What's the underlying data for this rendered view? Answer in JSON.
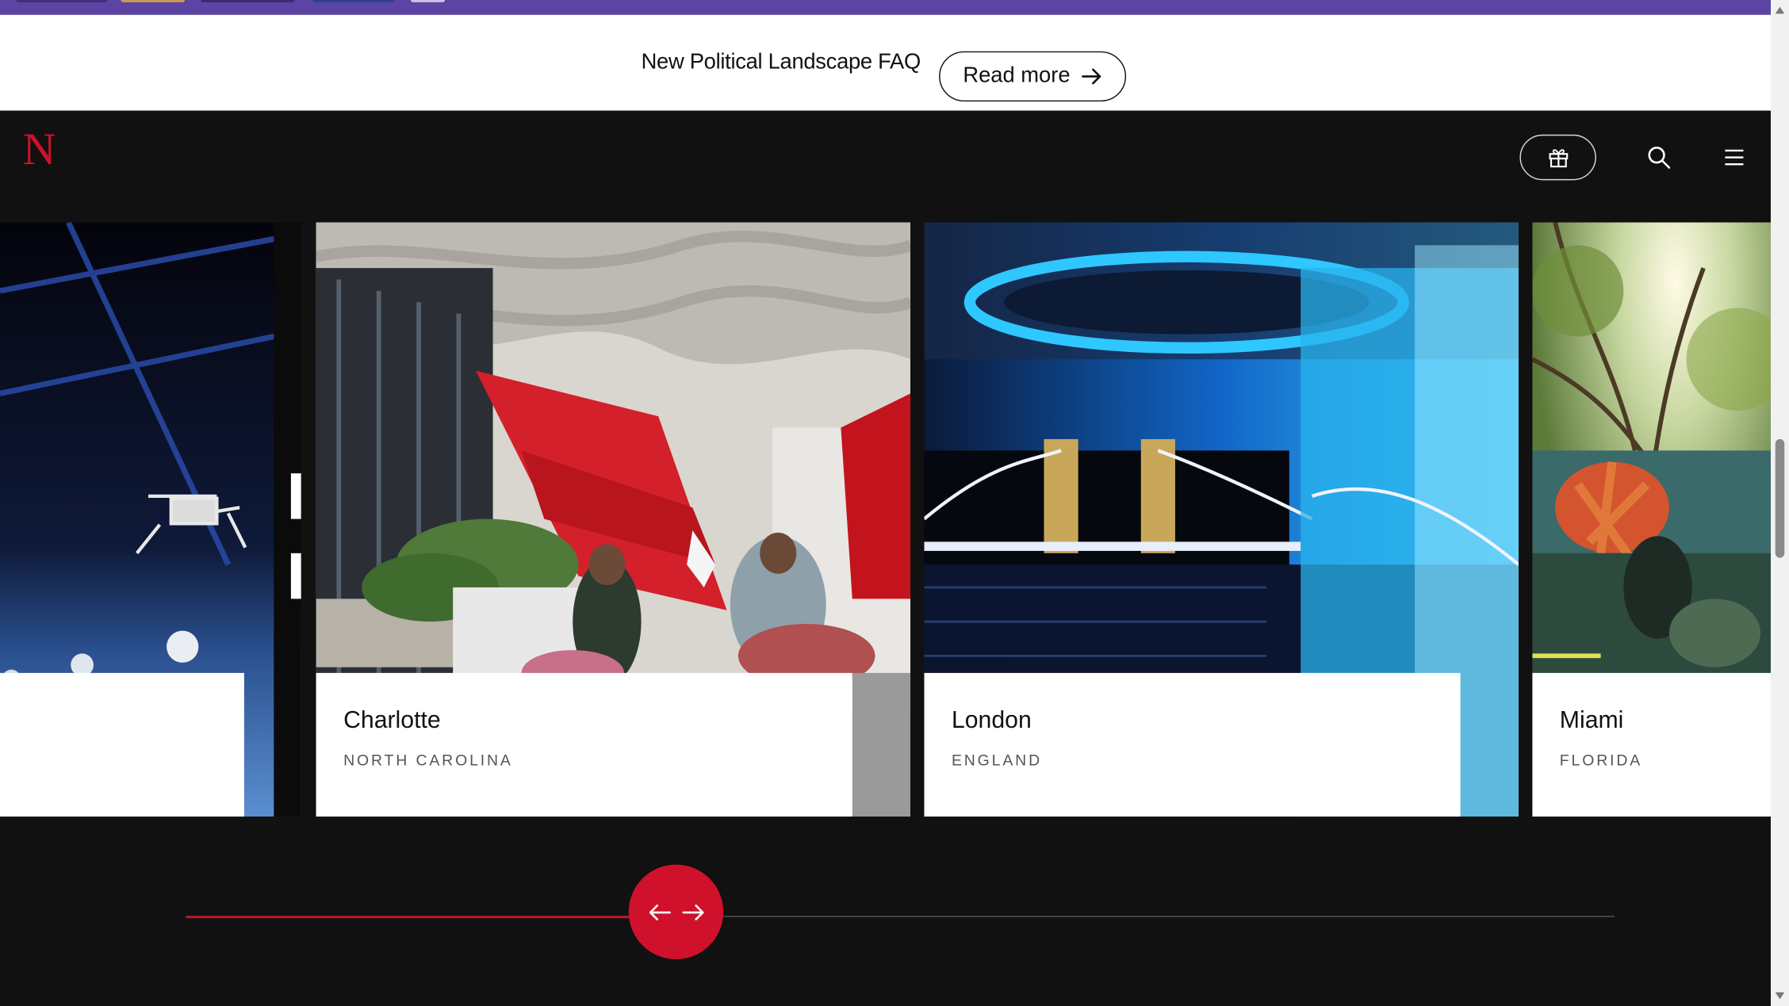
{
  "announcement": {
    "text": "New Political Landscape FAQ",
    "button_label": "Read more"
  },
  "header": {
    "logo": "N",
    "icons": [
      "gift-icon",
      "search-icon",
      "menu-icon"
    ]
  },
  "cards": [
    {
      "city": "",
      "region": ""
    },
    {
      "city": "Charlotte",
      "region": "NORTH CAROLINA"
    },
    {
      "city": "London",
      "region": "ENGLAND"
    },
    {
      "city": "Miami",
      "region": "FLORIDA"
    }
  ],
  "slider": {
    "icons": [
      "arrow-left-icon",
      "arrow-right-icon"
    ]
  },
  "colors": {
    "accent": "#d0112b",
    "topbar": "#5b44a3",
    "background": "#111111"
  }
}
